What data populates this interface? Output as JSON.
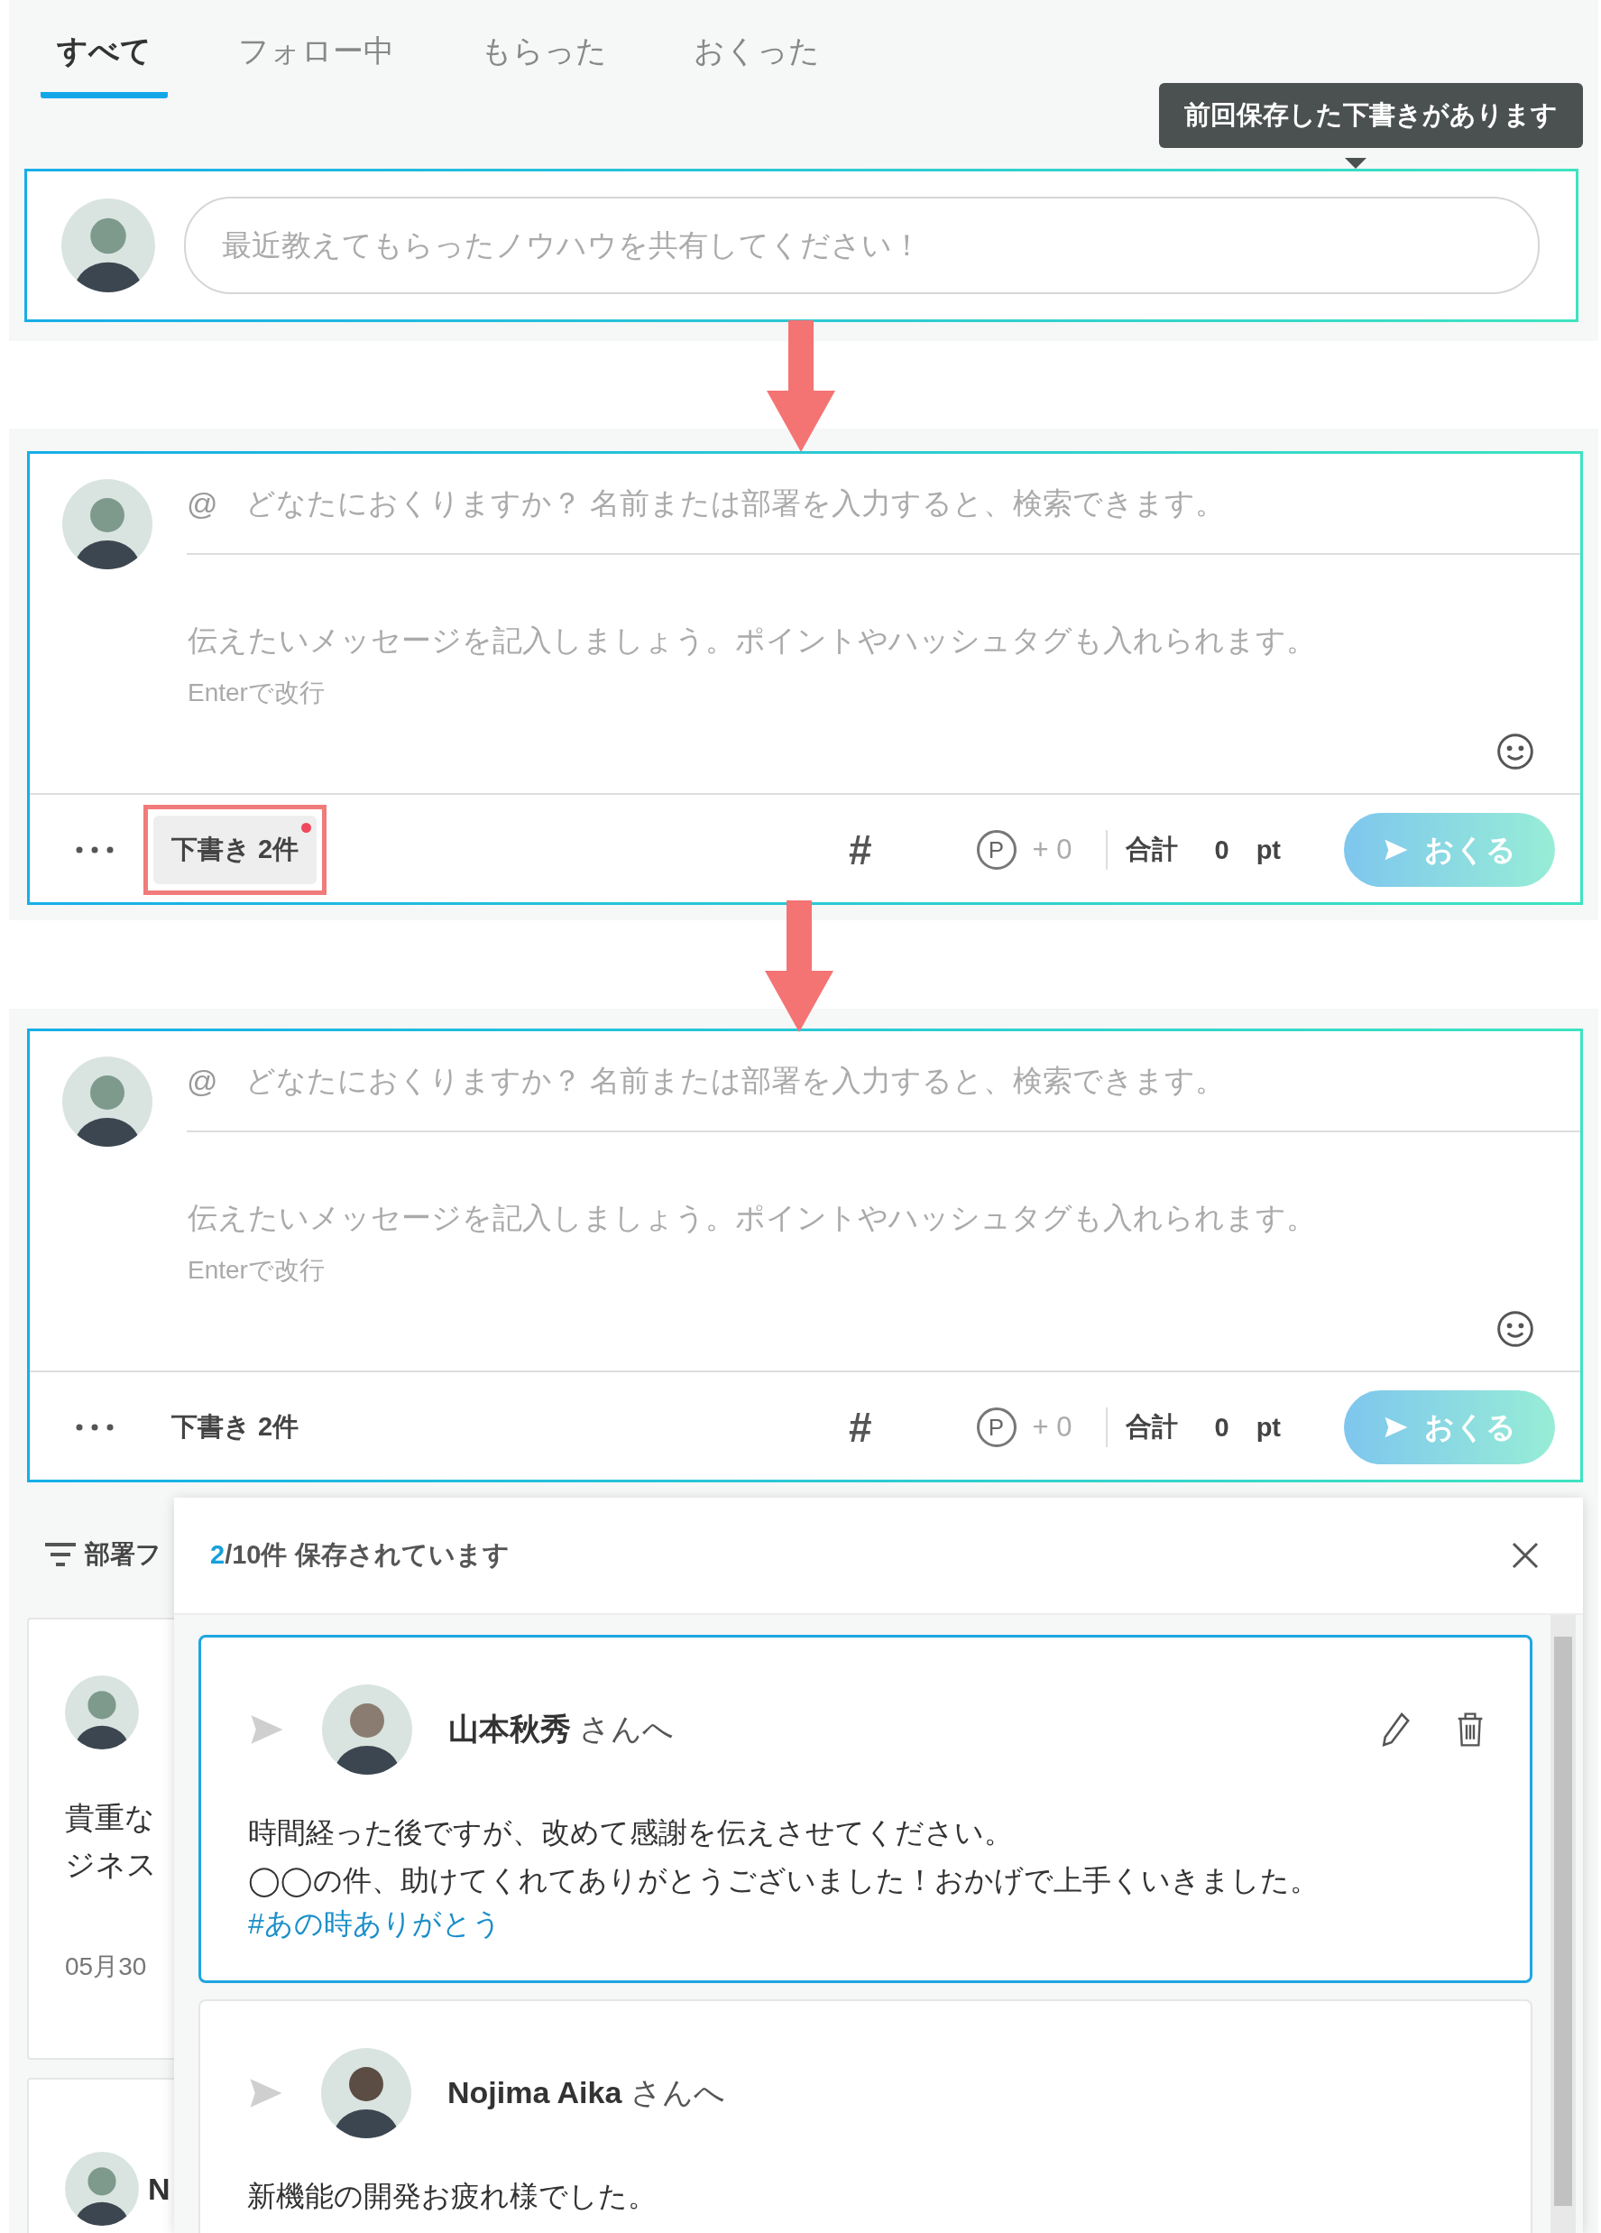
{
  "tabs": [
    {
      "label": "すべて",
      "selected": true
    },
    {
      "label": "フォロー中",
      "selected": false
    },
    {
      "label": "もらった",
      "selected": false
    },
    {
      "label": "おくった",
      "selected": false
    }
  ],
  "tooltip": "前回保存した下書きがあります",
  "quick_post": {
    "placeholder": "最近教えてもらったノウハウを共有してください！"
  },
  "composers": [
    {
      "at_sign": "@",
      "recipient_placeholder": "どなたにおくりますか？ 名前または部署を入力すると、検索できます。",
      "message_placeholder": "伝えたいメッセージを記入しましょう。ポイントやハッシュタグも入れられます。",
      "hint": "Enterで改行",
      "draft_button": {
        "label": "下書き 2件",
        "unread": true,
        "hovered": true,
        "annotated": true
      },
      "hashtag": "#",
      "point_symbol": "P",
      "points": "+ 0",
      "total_label": "合計",
      "total_value": "0",
      "unit": "pt",
      "send": "おくる"
    },
    {
      "at_sign": "@",
      "recipient_placeholder": "どなたにおくりますか？ 名前または部署を入力すると、検索できます。",
      "message_placeholder": "伝えたいメッセージを記入しましょう。ポイントやハッシュタグも入れられます。",
      "hint": "Enterで改行",
      "draft_button": {
        "label": "下書き 2件",
        "unread": false,
        "hovered": false,
        "annotated": false
      },
      "hashtag": "#",
      "point_symbol": "P",
      "points": "+ 0",
      "total_label": "合計",
      "total_value": "0",
      "unit": "pt",
      "send": "おくる"
    }
  ],
  "feed": {
    "filter": "部署フ",
    "posts": [
      {
        "lines": [
          "貴重な",
          "ジネス"
        ],
        "date": "05月30"
      },
      {
        "name": "N"
      }
    ]
  },
  "drafts_panel": {
    "count": "2",
    "summary": "/10件 保存されています",
    "drafts": [
      {
        "recipient": "山本秋秀",
        "suffix": "さんへ",
        "lines": [
          "時間経った後ですが、改めて感謝を伝えさせてください。",
          "◯◯の件、助けてくれてありがとうございました！おかげで上手くいきました。"
        ],
        "hashtag": "#あの時ありがとう",
        "selected": true
      },
      {
        "recipient": "Nojima Aika",
        "suffix": "さんへ",
        "lines": [
          "新機能の開発お疲れ様でした。"
        ],
        "selected": false
      }
    ]
  }
}
